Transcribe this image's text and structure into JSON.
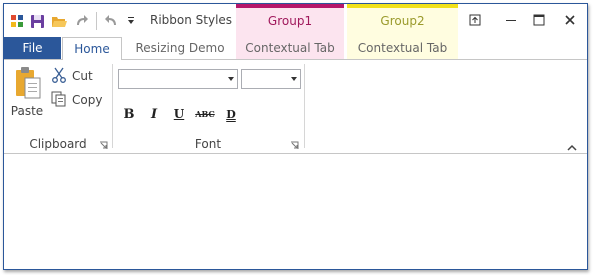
{
  "window": {
    "title": "Ribbon Styles",
    "accent": "#2b579a",
    "controls": [
      "restore-down-icon",
      "minimize-icon",
      "maximize-icon",
      "close-icon"
    ]
  },
  "qat": {
    "icons": [
      "app-icon",
      "save-icon",
      "open-folder-icon",
      "redo-icon",
      "undo-icon",
      "customize-dropdown-icon"
    ]
  },
  "contextual_groups": [
    {
      "name": "Group1",
      "tab": "Contextual Tab",
      "color": "#b5176a"
    },
    {
      "name": "Group2",
      "tab": "Contextual Tab",
      "color": "#f2e11a"
    }
  ],
  "tabs": {
    "file": "File",
    "home": "Home",
    "resizing": "Resizing Demo"
  },
  "clipboard": {
    "label": "Clipboard",
    "paste": "Paste",
    "cut": "Cut",
    "copy": "Copy"
  },
  "font": {
    "label": "Font",
    "family_value": "",
    "size_value": "",
    "buttons": [
      "B",
      "I",
      "U",
      "ABC",
      "D"
    ]
  }
}
